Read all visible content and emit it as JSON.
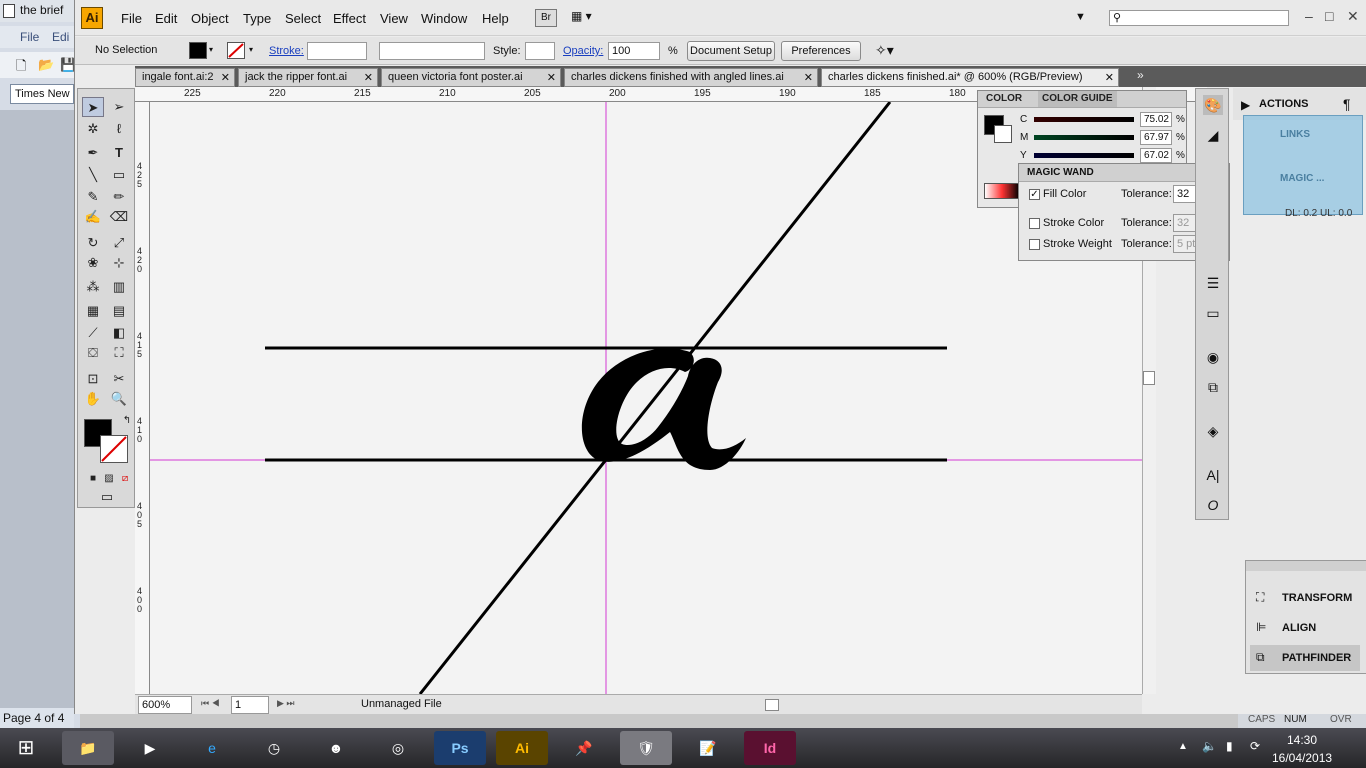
{
  "bg_word": {
    "title": "the brief",
    "menu_file": "File",
    "menu_edit": "Edi",
    "font": "Times New R",
    "page_status": "Page 4 of 4"
  },
  "app": {
    "logo": "Ai",
    "menu": [
      "File",
      "Edit",
      "Object",
      "Type",
      "Select",
      "Effect",
      "View",
      "Window",
      "Help"
    ],
    "bridge": "Br",
    "search_placeholder": "",
    "win_controls": [
      "–",
      "□",
      "✕"
    ]
  },
  "control_bar": {
    "selection": "No Selection",
    "stroke_label": "Stroke:",
    "style_label": "Style:",
    "opacity_label": "Opacity:",
    "opacity_value": "100",
    "opacity_unit": "%",
    "document_setup": "Document Setup",
    "preferences": "Preferences"
  },
  "tabs": [
    {
      "label": "ingale font.ai:2",
      "close": "✕"
    },
    {
      "label": "jack the ripper font.ai",
      "close": "✕"
    },
    {
      "label": "queen victoria font poster.ai",
      "close": "✕"
    },
    {
      "label": "charles dickens finished with angled lines.ai",
      "close": "✕"
    },
    {
      "label": "charles dickens finished.ai* @ 600% (RGB/Preview)",
      "close": "✕"
    }
  ],
  "ruler_h": [
    "225",
    "220",
    "215",
    "210",
    "205",
    "200",
    "195",
    "190",
    "185",
    "180"
  ],
  "ruler_v": [
    "425",
    "420",
    "415",
    "410",
    "405",
    "400"
  ],
  "color_panel": {
    "tab1": "COLOR",
    "tab2": "COLOR GUIDE",
    "rows": [
      {
        "label": "C",
        "value": "75.02",
        "unit": "%"
      },
      {
        "label": "M",
        "value": "67.97",
        "unit": "%"
      },
      {
        "label": "Y",
        "value": "67.02",
        "unit": "%"
      }
    ]
  },
  "magic_wand": {
    "title": "MAGIC WAND",
    "rows": [
      {
        "label": "Fill Color",
        "checked": "✓",
        "tol_label": "Tolerance:",
        "tol": "32"
      },
      {
        "label": "Stroke Color",
        "checked": "",
        "tol_label": "Tolerance:",
        "tol": "32"
      },
      {
        "label": "Stroke Weight",
        "checked": "",
        "tol_label": "Tolerance:",
        "tol": "5 pt"
      }
    ]
  },
  "side_panels": {
    "actions": "ACTIONS",
    "links": "LINKS",
    "magic": "MAGIC ...",
    "dl_status": "DL: 0.2 UL: 0.0",
    "transform": "TRANSFORM",
    "align": "ALIGN",
    "pathfinder": "PATHFINDER"
  },
  "status_bar": {
    "zoom": "600%",
    "artboard": "1",
    "file_status": "Unmanaged File"
  },
  "word_status": [
    "CAPS",
    "NUM",
    "OVR"
  ],
  "taskbar": {
    "apps": [
      "Ps",
      "Ai",
      "Id"
    ],
    "time": "14:30",
    "date": "16/04/2013"
  }
}
